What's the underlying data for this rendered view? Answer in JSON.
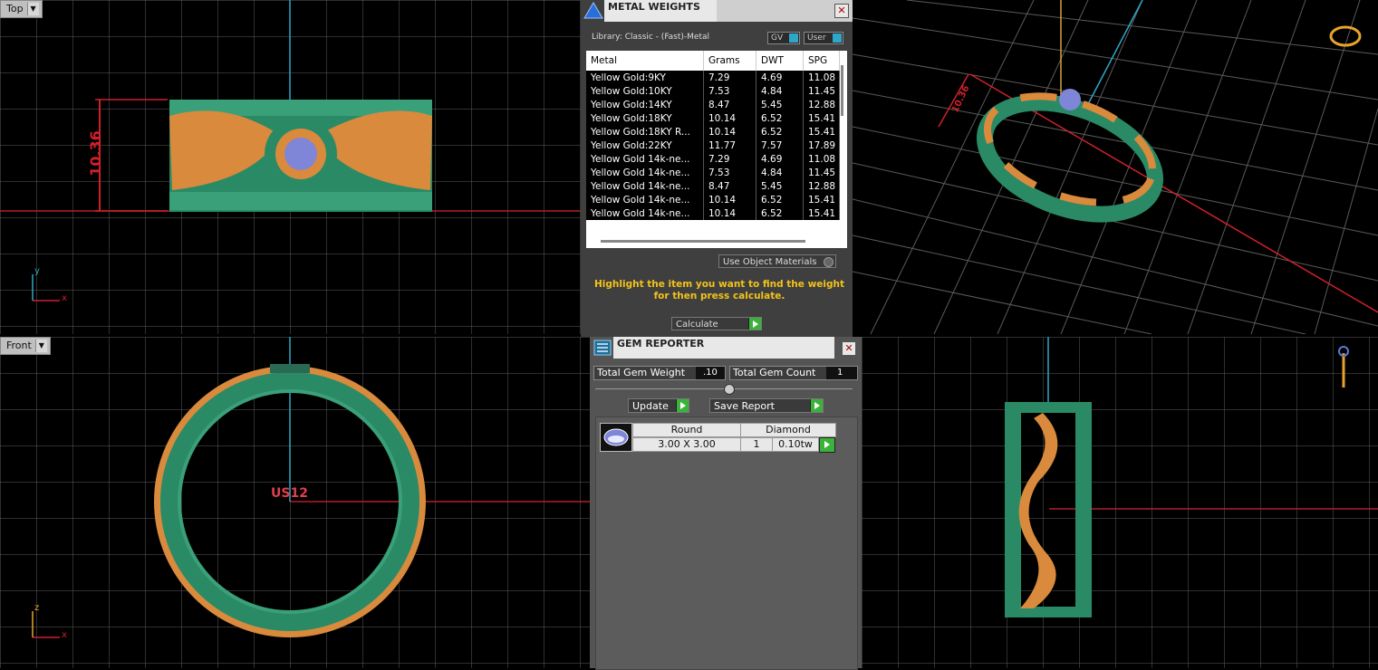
{
  "viewports": {
    "top": {
      "label": "Top",
      "dimension": "10.36",
      "axis_x": "x",
      "axis_y": "y"
    },
    "perspective": {
      "dimension": "10.36"
    },
    "front": {
      "label": "Front",
      "size_label": "US12",
      "axis_x": "x",
      "axis_z": "z"
    }
  },
  "metal_weights": {
    "title": "METAL WEIGHTS",
    "library": "Library: Classic - (Fast)-Metal",
    "gv_label": "GV",
    "user_label": "User",
    "columns": [
      "Metal",
      "Grams",
      "DWT",
      "SPG"
    ],
    "rows": [
      {
        "metal": "Yellow Gold:9KY",
        "grams": "7.29",
        "dwt": "4.69",
        "spg": "11.08"
      },
      {
        "metal": "Yellow Gold:10KY",
        "grams": "7.53",
        "dwt": "4.84",
        "spg": "11.45"
      },
      {
        "metal": "Yellow Gold:14KY",
        "grams": "8.47",
        "dwt": "5.45",
        "spg": "12.88"
      },
      {
        "metal": "Yellow Gold:18KY",
        "grams": "10.14",
        "dwt": "6.52",
        "spg": "15.41"
      },
      {
        "metal": "Yellow Gold:18KY R...",
        "grams": "10.14",
        "dwt": "6.52",
        "spg": "15.41"
      },
      {
        "metal": "Yellow Gold:22KY",
        "grams": "11.77",
        "dwt": "7.57",
        "spg": "17.89"
      },
      {
        "metal": "Yellow Gold 14k-ne...",
        "grams": "7.29",
        "dwt": "4.69",
        "spg": "11.08"
      },
      {
        "metal": "Yellow Gold 14k-ne...",
        "grams": "7.53",
        "dwt": "4.84",
        "spg": "11.45"
      },
      {
        "metal": "Yellow Gold 14k-ne...",
        "grams": "8.47",
        "dwt": "5.45",
        "spg": "12.88"
      },
      {
        "metal": "Yellow Gold 14k-ne...",
        "grams": "10.14",
        "dwt": "6.52",
        "spg": "15.41"
      },
      {
        "metal": "Yellow Gold 14k-ne...",
        "grams": "10.14",
        "dwt": "6.52",
        "spg": "15.41"
      }
    ],
    "use_object_materials": "Use Object Materials",
    "instruction": "Highlight the item you want to find the weight for then press calculate.",
    "calculate": "Calculate"
  },
  "gem_reporter": {
    "title": "GEM REPORTER",
    "total_gem_weight_label": "Total Gem Weight",
    "total_gem_weight": ".10",
    "total_gem_count_label": "Total Gem Count",
    "total_gem_count": "1",
    "update": "Update",
    "save_report": "Save Report",
    "gem": {
      "shape": "Round",
      "type": "Diamond",
      "size": "3.00 X 3.00",
      "count": "1",
      "weight": "0.10tw"
    }
  },
  "colors": {
    "grid": "#6e6e6e",
    "ring_green": "#2a8a66",
    "ring_gold": "#d98a3c",
    "dim_red": "#d0202a",
    "axis_cyan": "#2fa7c8",
    "instruction_yellow": "#f2c21a",
    "button_green": "#3bb33b"
  }
}
